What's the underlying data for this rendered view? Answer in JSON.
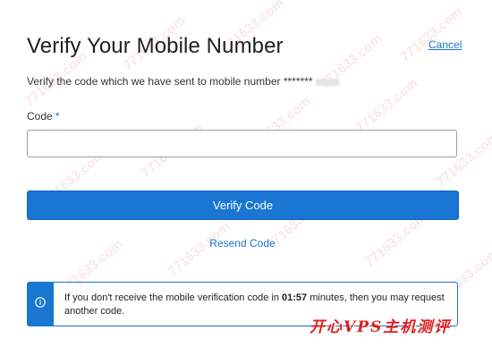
{
  "header": {
    "title": "Verify Your Mobile Number",
    "cancel_label": "Cancel"
  },
  "subtitle": {
    "text": "Verify the code which we have sent to mobile number *******",
    "masked_digits": "4833"
  },
  "form": {
    "code_label": "Code",
    "required_mark": "*",
    "code_value": "",
    "verify_label": "Verify Code",
    "resend_label": "Resend Code"
  },
  "notice": {
    "icon": "info-circle-icon",
    "before_time": "If you don't receive the mobile verification code in ",
    "time": "01:57",
    "after_time": " minutes, then you may request another code."
  },
  "watermark": {
    "repeated_text": "771633.com",
    "corner_text": "开心VPS主机测评"
  },
  "colors": {
    "accent": "#1976d2",
    "link": "#1a73c8",
    "watermark_red": "#e11d1d"
  }
}
